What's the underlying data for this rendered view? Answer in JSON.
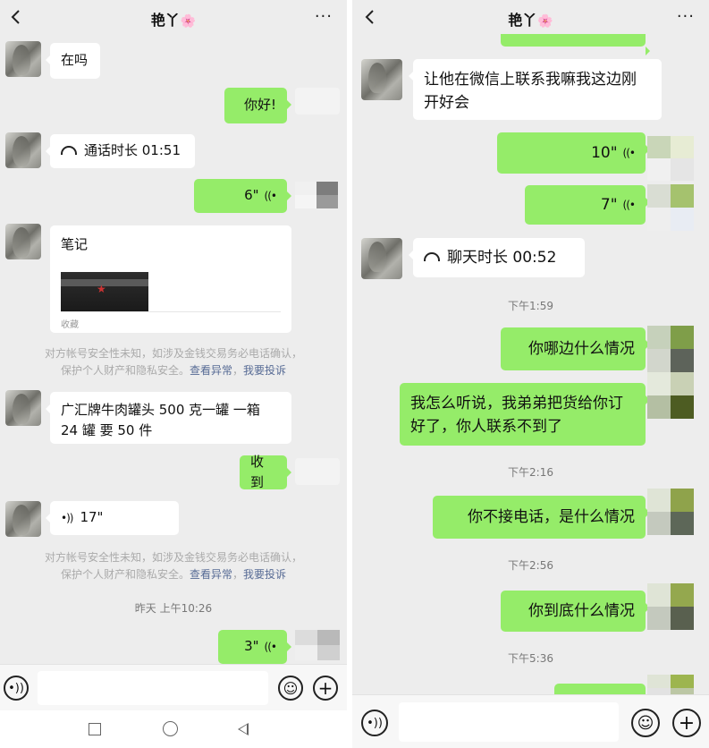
{
  "left": {
    "header": {
      "title": "艳丫",
      "flower": "🌸",
      "more": "···"
    },
    "messages": {
      "m1": "在吗",
      "m2": "你好!",
      "m3_label": "通话时长 01:51",
      "m4": "6\"",
      "note_title": "笔记",
      "note_footer": "收藏",
      "m6": "广汇牌牛肉罐头 500 克一罐 一箱 24 罐 要 50 件",
      "m7": "收到",
      "m8": "17\"",
      "m9": "3\""
    },
    "security": {
      "line1": "对方帐号安全性未知，如涉及金钱交易务必电话确认，",
      "line2": "保护个人财产和隐私安全。",
      "link1": "查看异常",
      "link2": "我要投诉"
    },
    "timestamp1": "昨天 上午10:26"
  },
  "right": {
    "header": {
      "title": "艳丫",
      "flower": "🌸",
      "more": "···"
    },
    "messages": {
      "r1": "让他在微信上联系我嘛我这边刚开好会",
      "r2": "10\"",
      "r3": "7\"",
      "r4_label": "聊天时长 00:52",
      "r5": "你哪边什么情况",
      "r6": "我怎么听说，我弟弟把货给你订好了，你人联系不到了",
      "r7": "你不接电话，是什么情况",
      "r8": "你到底什么情况"
    },
    "timestamps": {
      "t1": "下午1:59",
      "t2": "下午2:16",
      "t3": "下午2:56",
      "t4": "下午5:36"
    }
  },
  "icons": {
    "back": "chevron-left-icon",
    "more": "more-dots-icon",
    "voice_toggle": "voice-icon",
    "emoji": "emoji-icon",
    "plus": "plus-icon",
    "phone": "phone-icon",
    "voice_wave": "voice-wave-icon"
  },
  "colors": {
    "background": "#ededed",
    "bubble_out": "#95ec69",
    "bubble_in": "#ffffff",
    "link": "#576b95"
  }
}
